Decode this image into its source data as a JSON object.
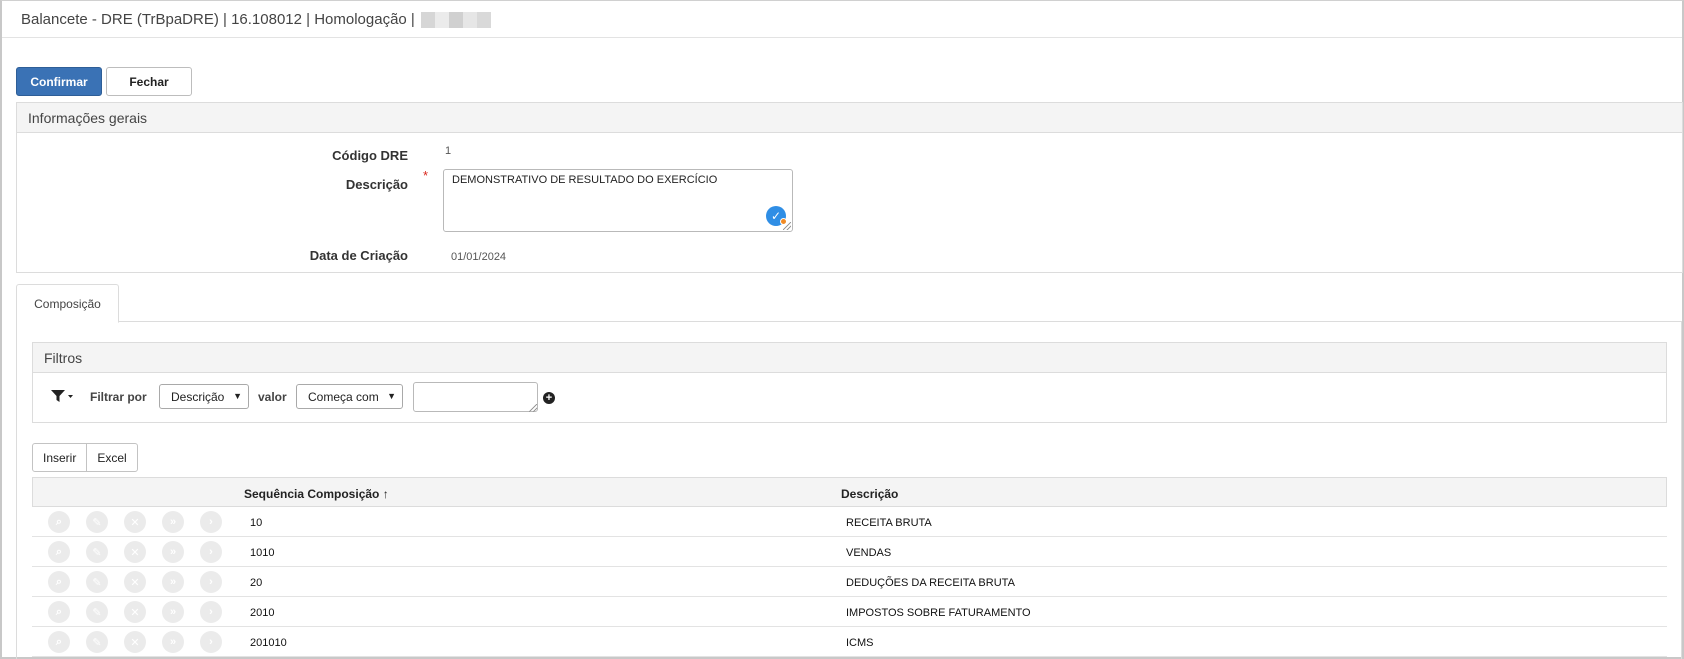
{
  "window": {
    "title": "Balancete - DRE (TrBpaDRE) | 16.108012 | Homologação |"
  },
  "actions": {
    "confirm_label": "Confirmar",
    "close_label": "Fechar"
  },
  "general_info": {
    "title": "Informações gerais",
    "code_label": "Código DRE",
    "code_value": "1",
    "description_label": "Descrição",
    "required_mark": "*",
    "description_value": "DEMONSTRATIVO DE RESULTADO DO EXERCÍCIO",
    "created_label": "Data de Criação",
    "created_value": "01/01/2024"
  },
  "tabs": [
    {
      "label": "Composição",
      "active": true
    }
  ],
  "filters": {
    "title": "Filtros",
    "filter_by_label": "Filtrar por",
    "filter_by_selected": "Descrição",
    "value_label": "valor",
    "operator_selected": "Começa com",
    "filter_value": ""
  },
  "grid_toolbar": {
    "insert_label": "Inserir",
    "excel_label": "Excel"
  },
  "grid": {
    "columns": {
      "sequence": "Sequência Composição",
      "sort_indicator": "🠕",
      "description": "Descrição"
    },
    "rows": [
      {
        "sequence": "10",
        "description": "RECEITA BRUTA"
      },
      {
        "sequence": "1010",
        "description": "VENDAS"
      },
      {
        "sequence": "20",
        "description": "DEDUÇÕES DA RECEITA BRUTA"
      },
      {
        "sequence": "2010",
        "description": "IMPOSTOS SOBRE FATURAMENTO"
      },
      {
        "sequence": "201010",
        "description": "ICMS"
      }
    ],
    "row_action_icons": [
      "search-icon",
      "edit-icon",
      "delete-icon",
      "forward-double-icon",
      "chevron-right-icon"
    ]
  },
  "colors": {
    "primary": "#3a72b5",
    "required": "#d9261c",
    "validation": "#2f8ee5",
    "validation_dot": "#f08a24"
  }
}
